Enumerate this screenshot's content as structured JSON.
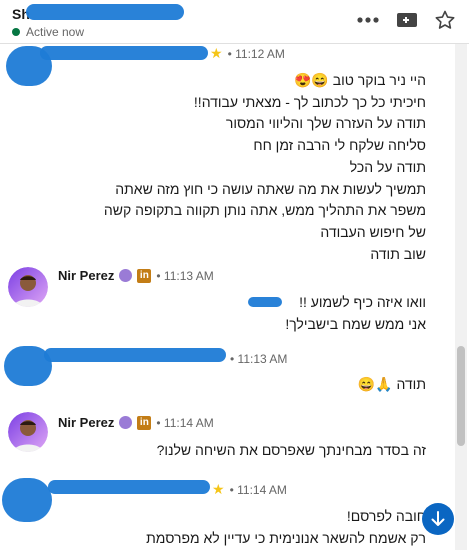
{
  "header": {
    "name": "Sh",
    "status": "Active now"
  },
  "messages": [
    {
      "sender": "",
      "time": "11:12 AM",
      "lines": [
        "היי ניר בוקר טוב 😄😍",
        "חיכיתי כל כך לכתוב לך -  מצאתי עבודה!!",
        "תודה על העזרה שלך והליווי המסור",
        "סליחה שלקח לי הרבה זמן חח",
        "תודה על הכל",
        "תמשיך לעשות את מה שאתה עושה כי חוץ מזה שאתה",
        "משפר את התהליך ממש, אתה נותן תקווה בתקופה קשה",
        "של חיפוש העבודה",
        "שוב תודה"
      ]
    },
    {
      "sender": "Nir Perez",
      "time": "11:13 AM",
      "lines": [
        "וואו איזה כיף לשמוע !!",
        "אני ממש שמח בישבילך!"
      ]
    },
    {
      "sender": "",
      "time": "11:13 AM",
      "lines": [
        "תודה 🙏😄"
      ]
    },
    {
      "sender": "Nir Perez",
      "time": "11:14 AM",
      "lines": [
        "זה בסדר מבחינתך שאפרסם את השיחה שלנו?"
      ]
    },
    {
      "sender": "",
      "time": "11:14 AM",
      "lines": [
        "חובה לפרסם!",
        "רק אשמח להשאר אנונימית כי עדיין לא מפרסמת"
      ]
    }
  ]
}
